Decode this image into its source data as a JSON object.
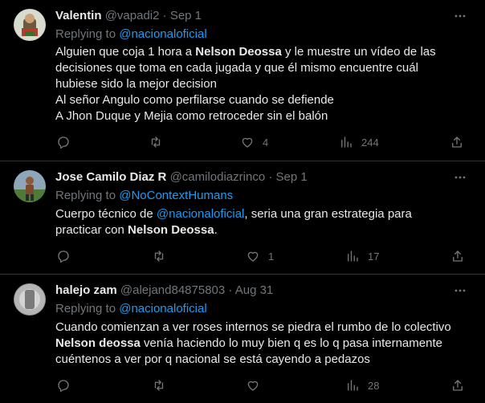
{
  "replying_to_label": "Replying to",
  "tweets": [
    {
      "name": "Valentin",
      "handle": "@vapadi2",
      "separator": "·",
      "date": "Sep 1",
      "reply_mention": "@nacionaloficial",
      "body": [
        [
          {
            "t": "Alguien que coja 1 hora a "
          },
          {
            "t": "Nelson Deossa",
            "s": "bold"
          },
          {
            "t": " y le muestre un vídeo de las"
          }
        ],
        [
          {
            "t": "decisiones que toma en cada jugada y que él mismo encuentre cuál"
          }
        ],
        [
          {
            "t": "hubiese sido la mejor decision"
          }
        ],
        [
          {
            "t": "Al señor Angulo como perfilarse cuando se defiende"
          }
        ],
        [
          {
            "t": "A Jhon Duque y Mejia como retroceder sin el balón"
          }
        ]
      ],
      "likes": "4",
      "views": "244"
    },
    {
      "name": "Jose Camilo Diaz R",
      "handle": "@camilodiazrinco",
      "separator": "·",
      "date": "Sep 1",
      "reply_mention": "@NoContextHumans",
      "body": [
        [
          {
            "t": "Cuerpo técnico de "
          },
          {
            "t": "@nacionaloficial",
            "s": "mention"
          },
          {
            "t": ", seria una gran estrategia para"
          }
        ],
        [
          {
            "t": "practicar con "
          },
          {
            "t": "Nelson Deossa",
            "s": "bold"
          },
          {
            "t": "."
          }
        ]
      ],
      "likes": "1",
      "views": "17"
    },
    {
      "name": "halejo zam",
      "handle": "@alejand84875803",
      "separator": "·",
      "date": "Aug 31",
      "reply_mention": "@nacionaloficial",
      "body": [
        [
          {
            "t": "Cuando comienzan a ver roses internos se piedra el rumbo de lo colectivo"
          }
        ],
        [
          {
            "t": "Nelson deossa",
            "s": "bold"
          },
          {
            "t": " venía haciendo lo muy bien q es lo q pasa internamente"
          }
        ],
        [
          {
            "t": "cuéntenos a ver por q nacional se está cayendo a pedazos"
          }
        ]
      ],
      "likes": "",
      "views": "28"
    }
  ],
  "icons": {
    "reply": "speech-bubble-icon",
    "retweet": "retweet-icon",
    "like": "heart-icon",
    "views": "bar-chart-icon",
    "share": "share-upload-icon",
    "more": "ellipsis-icon"
  },
  "colors": {
    "background": "#000000",
    "text": "#e7e9ea",
    "muted": "#71767b",
    "mention": "#1d9bf0",
    "divider": "#2f3336"
  }
}
